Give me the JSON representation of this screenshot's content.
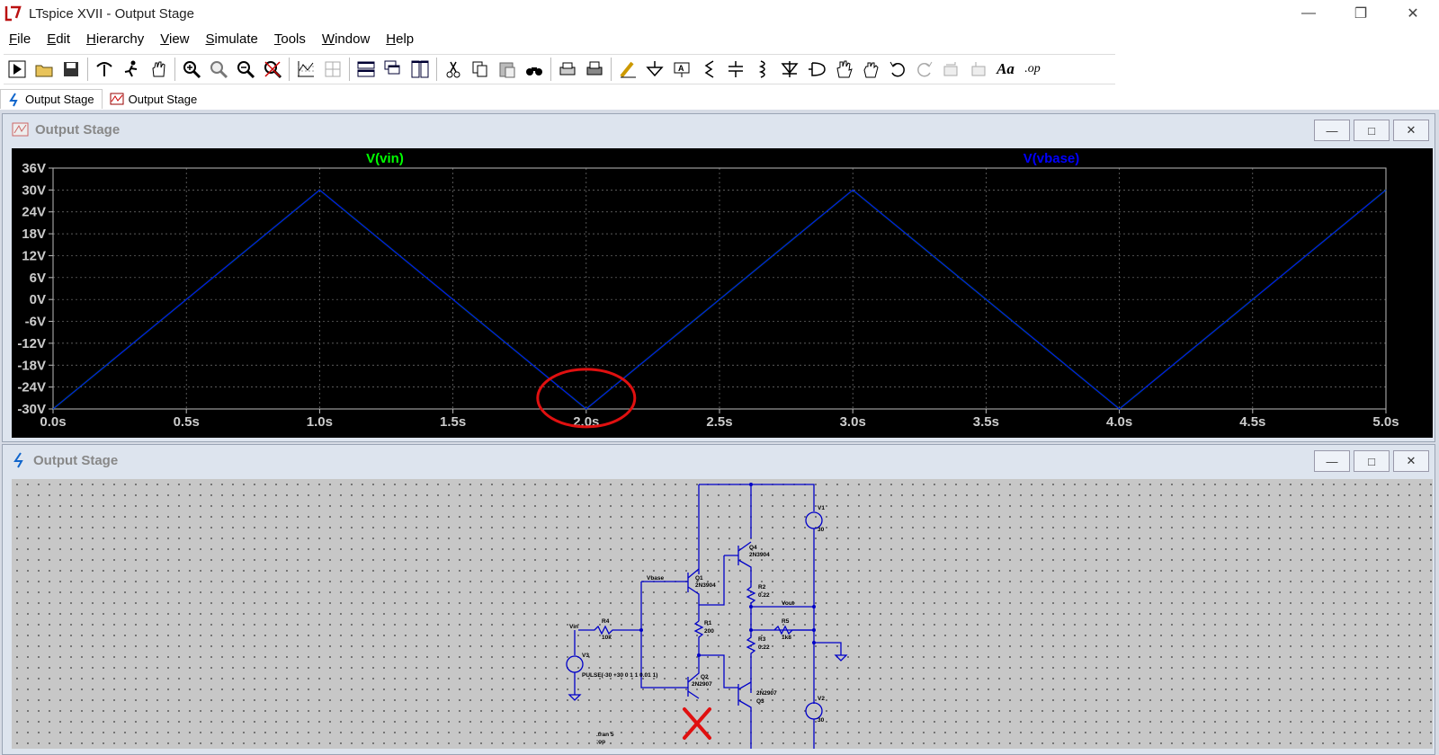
{
  "window": {
    "title": "LTspice XVII - Output Stage",
    "minimize": "—",
    "maximize": "❐",
    "close": "✕"
  },
  "menu": [
    {
      "pre": "",
      "u": "F",
      "post": "ile"
    },
    {
      "pre": "",
      "u": "E",
      "post": "dit"
    },
    {
      "pre": "",
      "u": "H",
      "post": "ierarchy"
    },
    {
      "pre": "",
      "u": "V",
      "post": "iew"
    },
    {
      "pre": "",
      "u": "S",
      "post": "imulate"
    },
    {
      "pre": "",
      "u": "T",
      "post": "ools"
    },
    {
      "pre": "",
      "u": "W",
      "post": "indow"
    },
    {
      "pre": "",
      "u": "H",
      "post": "elp"
    }
  ],
  "toolbar": {
    "icons": [
      "run-icon",
      "open-icon",
      "save-icon",
      "control-panel-icon",
      "halt-icon",
      "pan-icon",
      "zoom-in-icon",
      "zoom-box-icon",
      "zoom-out-icon",
      "zoom-fit-icon",
      "autorange-icon",
      "grid-icon",
      "tile-horizontal-icon",
      "cascade-icon",
      "tile-vertical-icon",
      "cut-icon",
      "copy-icon",
      "paste-icon",
      "find-icon",
      "print-preview-icon",
      "print-icon",
      "wire-icon",
      "ground-icon",
      "label-net-icon",
      "resistor-icon",
      "capacitor-icon",
      "inductor-icon",
      "diode-icon",
      "component-icon",
      "move-icon",
      "drag-icon",
      "undo-icon",
      "redo-icon",
      "rotate-icon",
      "mirror-icon",
      "text-icon",
      "spice-directive-icon"
    ],
    "text_label": "Aa",
    "op_label": ".op"
  },
  "tabs": [
    {
      "label": "Output Stage",
      "kind": "schematic"
    },
    {
      "label": "Output Stage",
      "kind": "waveform"
    }
  ],
  "waveform_window": {
    "title": "Output Stage",
    "min": "—",
    "max": "□",
    "close": "✕"
  },
  "schematic_window": {
    "title": "Output Stage",
    "min": "—",
    "max": "□",
    "close": "✕"
  },
  "chart_data": {
    "type": "line",
    "series": [
      {
        "name": "V(vin)",
        "color": "#00ff00",
        "x": [
          0,
          1,
          2,
          3,
          4,
          5
        ],
        "y": [
          -30,
          30,
          -30,
          30,
          -30,
          30
        ]
      },
      {
        "name": "V(vbase)",
        "color": "#0000ff",
        "x": [
          0,
          1,
          2,
          3,
          4,
          5
        ],
        "y": [
          -30,
          30,
          -30,
          30,
          -30,
          30
        ]
      }
    ],
    "x_ticks": [
      "0.0s",
      "0.5s",
      "1.0s",
      "1.5s",
      "2.0s",
      "2.5s",
      "3.0s",
      "3.5s",
      "4.0s",
      "4.5s",
      "5.0s"
    ],
    "y_ticks": [
      "36V",
      "30V",
      "24V",
      "18V",
      "12V",
      "6V",
      "0V",
      "-6V",
      "-12V",
      "-18V",
      "-24V",
      "-30V"
    ],
    "xlim": [
      0,
      5
    ],
    "ylim": [
      -30,
      36
    ],
    "grid": true,
    "annotation": "red circle around 2.0s minimum"
  },
  "schematic": {
    "labels": {
      "vbase": "Vbase",
      "vin": "Vin",
      "vout": "Vout",
      "q1": "Q1",
      "q1_model": "2N3904",
      "q2": "Q2",
      "q2_model": "2N2907",
      "q3": "Q3",
      "q3_model": "2N2907",
      "q4": "Q4",
      "q4_model": "2N3904",
      "r1": "R1",
      "r1_val": "200",
      "r2": "R2",
      "r2_val": "0.22",
      "r3": "R3",
      "r3_val": "0.22",
      "r4": "R4",
      "r4_val": "10k",
      "r5": "R5",
      "r5_val": "1k8",
      "v1": "V1",
      "v1_val": "30",
      "v2": "V2",
      "v2_val": "30",
      "v3": "V3",
      "v3_val": "PULSE(-30 +30 0 1 1 0.01 1)",
      "tran": ".tran 5",
      "tran2": ";op"
    }
  }
}
